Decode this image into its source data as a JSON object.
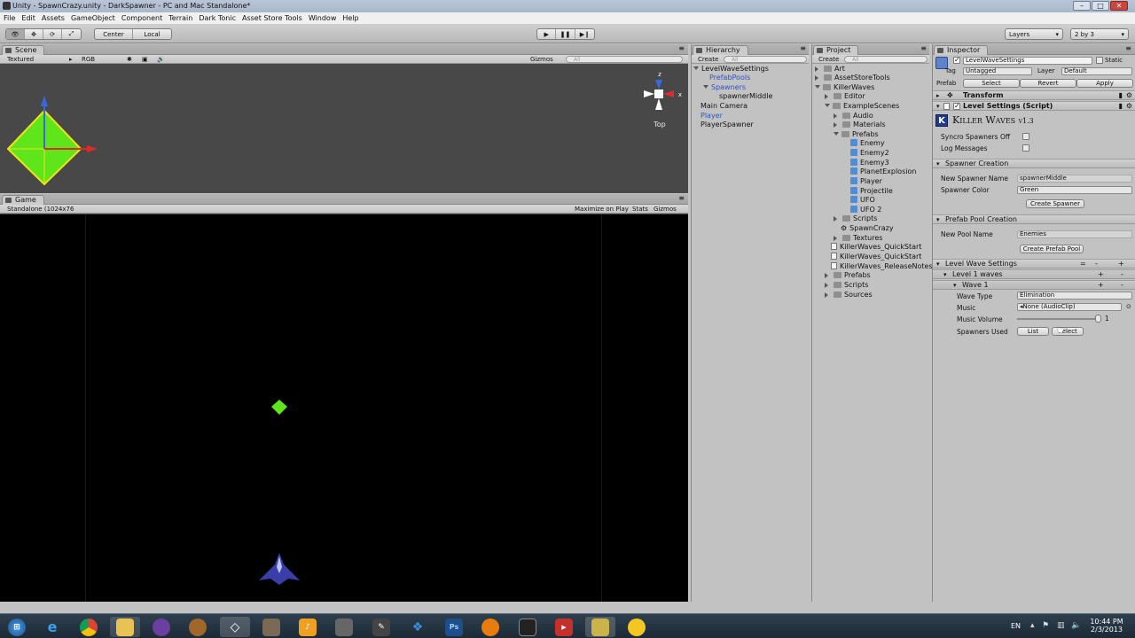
{
  "window": {
    "title": "Unity - SpawnCrazy.unity - DarkSpawner - PC and Mac Standalone*"
  },
  "menu": [
    "File",
    "Edit",
    "Assets",
    "GameObject",
    "Component",
    "Terrain",
    "Dark Tonic",
    "Asset Store Tools",
    "Window",
    "Help"
  ],
  "toolbar": {
    "center": "Center",
    "local": "Local",
    "layers": "Layers",
    "layout": "2 by 3"
  },
  "scene": {
    "tab": "Scene",
    "render_mode": "Textured",
    "rgb": "RGB",
    "gizmos": "Gizmos",
    "search_placeholder": "All",
    "view_label": "Top",
    "gizmo_axes": {
      "z": "z",
      "x": "x",
      "y": "y"
    }
  },
  "game": {
    "tab": "Game",
    "resolution": "Standalone (1024x76",
    "maximize": "Maximize on Play",
    "stats": "Stats",
    "gizmos": "Gizmos"
  },
  "hierarchy": {
    "tab": "Hierarchy",
    "create": "Create",
    "search_placeholder": "All",
    "items": [
      "LevelWaveSettings",
      "PrefabPools",
      "Spawners",
      "spawnerMiddle",
      "Main Camera",
      "Player",
      "PlayerSpawner"
    ]
  },
  "project": {
    "tab": "Project",
    "create": "Create",
    "search_placeholder": "All",
    "items": [
      "Art",
      "AssetStoreTools",
      "KillerWaves",
      "Editor",
      "ExampleScenes",
      "Audio",
      "Materials",
      "Prefabs",
      "Enemy",
      "Enemy2",
      "Enemy3",
      "PlanetExplosion",
      "Player",
      "Projectile",
      "UFO",
      "UFO 2",
      "Scripts",
      "SpawnCrazy",
      "Textures",
      "KillerWaves_QuickStart",
      "KillerWaves_QuickStart",
      "KillerWaves_ReleaseNotes",
      "Prefabs",
      "Scripts",
      "Sources"
    ]
  },
  "inspector": {
    "tab": "Inspector",
    "object_name": "LevelWaveSettings",
    "static": "Static",
    "tag_label": "Tag",
    "tag_value": "Untagged",
    "layer_label": "Layer",
    "layer_value": "Default",
    "prefab_label": "Prefab",
    "select": "Select",
    "revert": "Revert",
    "apply": "Apply",
    "transform": "Transform",
    "script_header": "Level Settings (Script)",
    "logo_k": "K",
    "logo_text": "Killer Waves",
    "logo_version": "v1.3",
    "syncro": "Syncro Spawners Off",
    "log_messages": "Log Messages",
    "spawner_creation": "Spawner Creation",
    "new_spawner_name_label": "New Spawner Name",
    "new_spawner_name_value": "spawnerMiddle",
    "spawner_color_label": "Spawner Color",
    "spawner_color_value": "Green",
    "create_spawner": "Create Spawner",
    "prefab_pool_creation": "Prefab Pool Creation",
    "new_pool_name_label": "New Pool Name",
    "new_pool_name_value": "Enemies",
    "create_prefab_pool": "Create Prefab Pool",
    "level_wave_settings": "Level Wave Settings",
    "level1": "Level 1 waves",
    "wave1": "Wave 1",
    "wave_type_label": "Wave Type",
    "wave_type_value": "Elimination",
    "music_label": "Music",
    "music_value": "None (AudioClip)",
    "music_volume_label": "Music Volume",
    "music_volume_value": "1",
    "spawners_used_label": "Spawners Used",
    "list": "List",
    "select2": "Select",
    "plus": "+",
    "minus": "-",
    "equals": "="
  },
  "tray": {
    "lang": "EN",
    "time": "10:44 PM",
    "date": "2/3/2013"
  },
  "colors": {
    "accent_blue": "#2c53c4",
    "gizmo_green": "#5ee61a",
    "game_bg": "#000000"
  }
}
